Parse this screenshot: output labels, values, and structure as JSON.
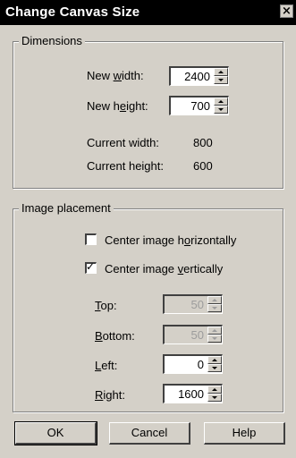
{
  "window": {
    "title": "Change Canvas Size",
    "close_glyph": "×"
  },
  "dimensions": {
    "group_label": "Dimensions",
    "new_width": {
      "pre": "New ",
      "mnemonic": "w",
      "post": "idth:",
      "value": "2400"
    },
    "new_height": {
      "pre": "New h",
      "mnemonic": "e",
      "post": "ight:",
      "value": "700"
    },
    "current_width": {
      "label": "Current width:",
      "value": "800"
    },
    "current_height": {
      "label": "Current height:",
      "value": "600"
    }
  },
  "placement": {
    "group_label": "Image placement",
    "center_h": {
      "pre": "Center image h",
      "mnemonic": "o",
      "post": "rizontally",
      "checked": false
    },
    "center_v": {
      "pre": "Center image ",
      "mnemonic": "v",
      "post": "ertically",
      "checked": true
    },
    "top": {
      "mnemonic": "T",
      "post": "op:",
      "value": "50",
      "enabled": false
    },
    "bottom": {
      "mnemonic": "B",
      "post": "ottom:",
      "value": "50",
      "enabled": false
    },
    "left": {
      "mnemonic": "L",
      "post": "eft:",
      "value": "0",
      "enabled": true
    },
    "right": {
      "mnemonic": "R",
      "post": "ight:",
      "value": "1600",
      "enabled": true
    }
  },
  "buttons": {
    "ok": "OK",
    "cancel": "Cancel",
    "help": "Help"
  }
}
